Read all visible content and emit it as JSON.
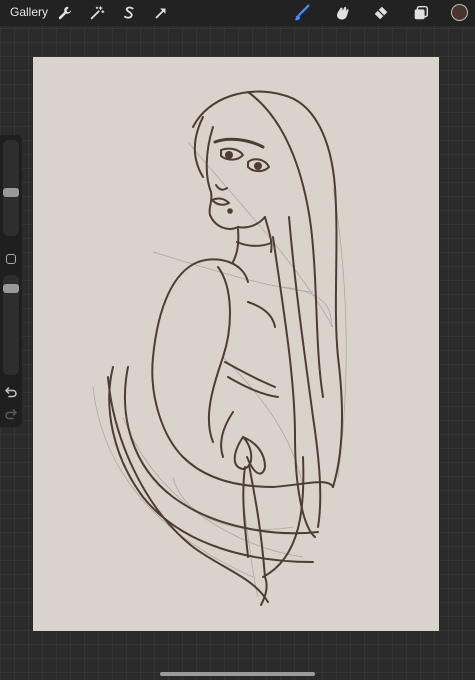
{
  "topbar": {
    "gallery_label": "Gallery",
    "left_tools": [
      {
        "icon": "wrench-icon",
        "name": "actions"
      },
      {
        "icon": "magic-wand-icon",
        "name": "adjustments"
      },
      {
        "icon": "selection-s-icon",
        "name": "selection"
      },
      {
        "icon": "arrow-cursor-icon",
        "name": "transform"
      }
    ],
    "right_tools": [
      {
        "icon": "brush-icon",
        "name": "paint",
        "active": true
      },
      {
        "icon": "smudge-icon",
        "name": "smudge"
      },
      {
        "icon": "eraser-icon",
        "name": "eraser"
      },
      {
        "icon": "layers-icon",
        "name": "layers"
      }
    ],
    "active_color": "#4a352c"
  },
  "sidebar": {
    "brush_size_level": 0.45,
    "opacity_level": 0.9
  },
  "colors": {
    "canvas_background": "#d9d3cc",
    "line_color": "#4e3d36",
    "sketch_color": "#a39a94",
    "accent_blue": "#3f8cff"
  }
}
